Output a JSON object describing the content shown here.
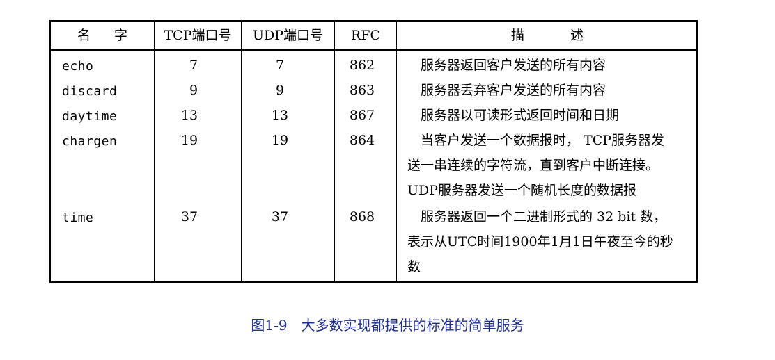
{
  "table": {
    "headers": {
      "name": "名 字",
      "tcp": "TCP端口号",
      "udp": "UDP端口号",
      "rfc": "RFC",
      "desc": "描 述"
    },
    "rows": [
      {
        "name": "echo",
        "tcp": "7",
        "udp": "7",
        "rfc": "862",
        "desc_lines": [
          "　服务器返回客户发送的所有内容"
        ]
      },
      {
        "name": "discard",
        "tcp": "9",
        "udp": "9",
        "rfc": "863",
        "desc_lines": [
          "　服务器丢弃客户发送的所有内容"
        ]
      },
      {
        "name": "daytime",
        "tcp": "13",
        "udp": "13",
        "rfc": "867",
        "desc_lines": [
          "　服务器以可读形式返回时间和日期"
        ]
      },
      {
        "name": "chargen",
        "tcp": "19",
        "udp": "19",
        "rfc": "864",
        "desc_lines": [
          "　当客户发送一个数据报时， TCP服务器发",
          "送一串连续的字符流，直到客户中断连接。",
          "UDP服务器发送一个随机长度的数据报"
        ]
      },
      {
        "name": "time",
        "tcp": "37",
        "udp": "37",
        "rfc": "868",
        "desc_lines": [
          "　服务器返回一个二进制形式的 32 bit 数，",
          "表示从UTC时间1900年1月1日午夜至今的秒",
          "数"
        ]
      }
    ]
  },
  "caption": {
    "label": "图1-9",
    "text": "大多数实现都提供的标准的简单服务"
  }
}
